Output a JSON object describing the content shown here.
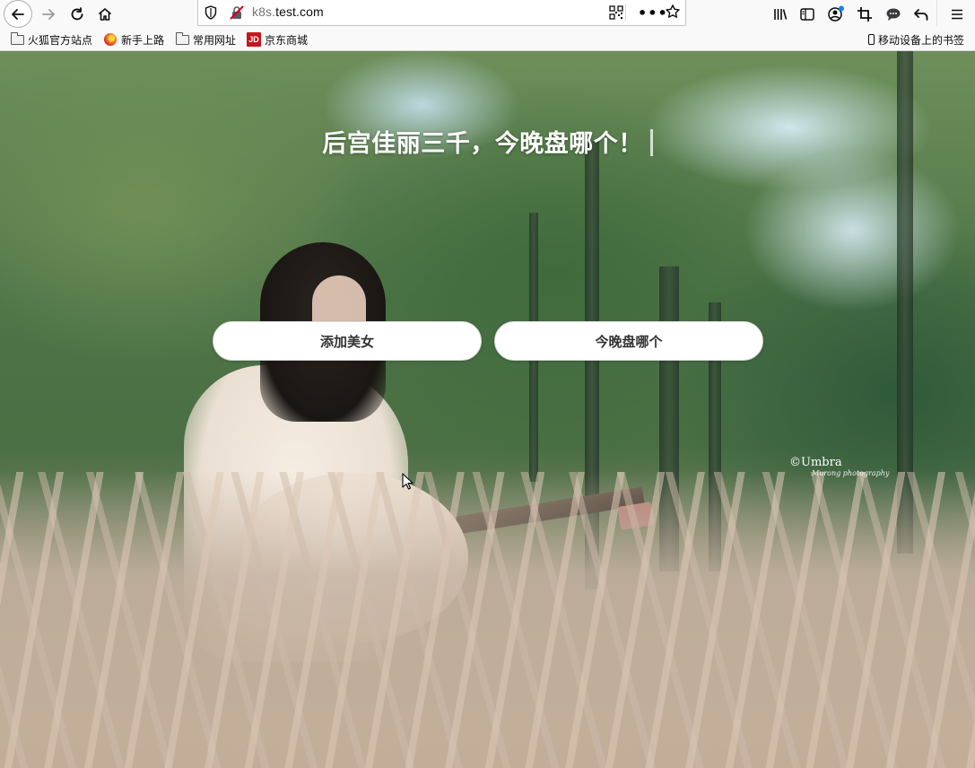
{
  "browser": {
    "url_prefix": "k8s.",
    "url_host": "test.com",
    "icons": [
      "back-icon",
      "forward-icon",
      "reload-icon",
      "home-icon",
      "shield-icon",
      "insecure-lock-icon",
      "qr-code-icon",
      "more-icon",
      "star-icon",
      "library-icon",
      "sidebar-icon",
      "account-icon",
      "screenshot-icon",
      "chat-icon",
      "undo-icon",
      "menu-icon"
    ]
  },
  "bookmarks": {
    "items": [
      {
        "label": "火狐官方站点",
        "icon": "folder-icon"
      },
      {
        "label": "新手上路",
        "icon": "firefox-icon"
      },
      {
        "label": "常用网址",
        "icon": "folder-icon"
      },
      {
        "label": "京东商城",
        "icon": "jd-icon"
      }
    ],
    "mobile": "移动设备上的书签",
    "jd_logo_text": "JD"
  },
  "page": {
    "headline": "后宫佳丽三千，今晚盘哪个！",
    "add_button": "添加美女",
    "pick_button": "今晚盘哪个",
    "watermark": "©Umbra",
    "watermark_sub": "Murong photography"
  }
}
